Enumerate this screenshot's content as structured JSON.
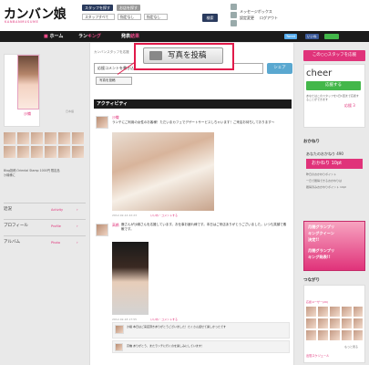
{
  "header": {
    "logo_main": "カンバン娘",
    "logo_sub": "KANBANMUSUME",
    "shop_staff_btn": "スタッフを探す",
    "shop_btn": "お店を探す",
    "select_staff": "スタッフすべて",
    "select_area": "指定なし",
    "select_area2": "指定なし",
    "search_btn": "検索",
    "link_message": "メッセージボックス",
    "link_settings": "設定変更",
    "link_logout": "ログアウト"
  },
  "nav": {
    "home": "ホーム",
    "ranking_a": "ラン",
    "ranking_b": "キング",
    "notice": "発表",
    "notice_hl": "結果",
    "share_tweet": "Tweet",
    "share_like": "いいね"
  },
  "left": {
    "profile_name": "沙織",
    "profile_lang": "日本語",
    "caption_line1": "Blog投稿 Oriental Stamp 1000円 限定品",
    "caption_line2": "沙織様に",
    "menu": [
      {
        "label": "近況",
        "en": "Activity"
      },
      {
        "label": "プロフィール",
        "en": "Profile"
      },
      {
        "label": "アルバム",
        "en": "Photo"
      }
    ]
  },
  "center": {
    "breadcrumb": "カンバンスタッフを応援",
    "comment_placeholder": "応援コメントを書き込む",
    "share_btn": "シェア",
    "photo_post_small": "写真を投稿",
    "photo_post_large": "写真を投稿",
    "activity_title": "アクティビティ",
    "posts": [
      {
        "name": "沙織",
        "text": "ランチにご利用の女性のお客様！ただいまカフェでデザートサービスしちゃいます！ご来店お待ちしております〜",
        "meta": "2012-02-14 22:23",
        "actions": "いいね・コメントする"
      },
      {
        "name": "高橋",
        "text": "鹿さんが沙織さんを応援しています。お仕事お疲れ様です。本日はご来店ありがとうございました。いつも笑顔で素敵です。",
        "meta": "2012-02-18 17:55",
        "actions": "いいね・コメントする",
        "reply1_name": "沙織",
        "reply1": "沙織 本日はご来店頂きありがとうございました！たくさん話せて楽しかったです",
        "reply2_name": "高橋",
        "reply2": "高橋 ありがとう、またランチに行くのを楽しみにしています！"
      }
    ]
  },
  "right": {
    "follow_btn": "この○○スタッフを応援",
    "cheer_title": "cheer",
    "cheer_btn": "応援する",
    "cheer_note": "あなたはこのスタッフを1日1回まで応援することができます",
    "cheer_count": "応援 3",
    "points_head": "おかねり",
    "points_total": "あなたのおかねり 490",
    "points_today": "おかねり 10pt",
    "points_line1": "昨日のおかねりポイント",
    "points_line2": "一日で獲得できるおかねりは",
    "points_line3": "獲得済みおかねりポイント 10pt",
    "ad_line1": "月間グランプリ",
    "ad_line2": "キングクイーン",
    "ad_line3": "決定!!",
    "ad_line4": "月間グランプリ",
    "ad_line5": "キング発表!!",
    "friends_head": "つながり",
    "friends_count": "応援ユーザー(20)",
    "friends_more": "もっと見る",
    "schedule_title": "出勤スケジュール",
    "colors": {
      "pink": "#e0337a",
      "green": "#43b74a",
      "blue": "#5aa8d0",
      "navy": "#2a3b5e",
      "highlight": "#e11a4a"
    }
  }
}
